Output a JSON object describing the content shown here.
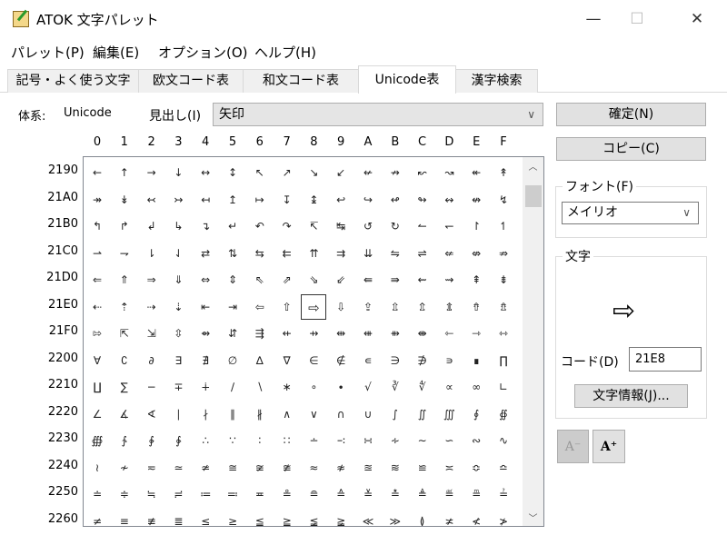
{
  "window": {
    "title": "ATOK 文字パレット",
    "minimize": "—",
    "maximize": "☐",
    "close": "✕"
  },
  "menu": [
    "パレット(P)",
    "編集(E)",
    "オプション(O)",
    "ヘルプ(H)"
  ],
  "tabs": [
    "記号・よく使う文字",
    "欧文コード表",
    "和文コード表",
    "Unicode表",
    "漢字検索"
  ],
  "active_tab": 3,
  "system": {
    "label": "体系:",
    "value": "Unicode"
  },
  "heading": {
    "label": "見出し(I)",
    "value": "矢印"
  },
  "columns": [
    "0",
    "1",
    "2",
    "3",
    "4",
    "5",
    "6",
    "7",
    "8",
    "9",
    "A",
    "B",
    "C",
    "D",
    "E",
    "F"
  ],
  "rows": [
    {
      "code": "2190",
      "chars": "←↑→↓↔↕↖↗↘↙↚↛↜↝↞↟"
    },
    {
      "code": "21A0",
      "chars": "↠↡↢↣↤↥↦↧↨↩↪↫↬↭↮↯"
    },
    {
      "code": "21B0",
      "chars": "↰↱↲↳↴↵↶↷↸↹↺↻↼↽↾↿"
    },
    {
      "code": "21C0",
      "chars": "⇀⇁⇂⇃⇄⇅⇆⇇⇈⇉⇊⇋⇌⇍⇎⇏"
    },
    {
      "code": "21D0",
      "chars": "⇐⇑⇒⇓⇔⇕⇖⇗⇘⇙⇚⇛⇜⇝⇞⇟"
    },
    {
      "code": "21E0",
      "chars": "⇠⇡⇢⇣⇤⇥⇦⇧⇨⇩⇪⇫⇬⇭⇮⇯"
    },
    {
      "code": "21F0",
      "chars": "⇰⇱⇲⇳⇴⇵⇶⇷⇸⇹⇺⇻⇼⇽⇾⇿"
    },
    {
      "code": "2200",
      "chars": "∀∁∂∃∄∅∆∇∈∉∊∋∌∍∎∏"
    },
    {
      "code": "2210",
      "chars": "∐∑−∓∔∕∖∗∘∙√∛∜∝∞∟"
    },
    {
      "code": "2220",
      "chars": "∠∡∢∣∤∥∦∧∨∩∪∫∬∭∮∯"
    },
    {
      "code": "2230",
      "chars": "∰∱∲∳∴∵∶∷∸∹∺∻∼∽∾∿"
    },
    {
      "code": "2240",
      "chars": "≀≁≂≃≄≅≆≇≈≉≊≋≌≍≎≏"
    },
    {
      "code": "2250",
      "chars": "≐≑≒≓≔≕≖≗≘≙≚≛≜≝≞≟"
    },
    {
      "code": "2260",
      "chars": "≠≡≢≣≤≥≦≧≨≩≪≫≬≭≮≯"
    }
  ],
  "selected": {
    "row": 5,
    "col": 8
  },
  "buttons": {
    "confirm": "確定(N)",
    "copy": "コピー(C)",
    "char_info": "文字情報(J)..."
  },
  "font": {
    "label": "フォント(F)",
    "value": "メイリオ"
  },
  "char_group": {
    "label": "文字",
    "preview": "⇨",
    "code_label": "コード(D)",
    "code_value": "21E8"
  },
  "size_buttons": {
    "smaller": "A⁻",
    "larger": "A⁺"
  }
}
